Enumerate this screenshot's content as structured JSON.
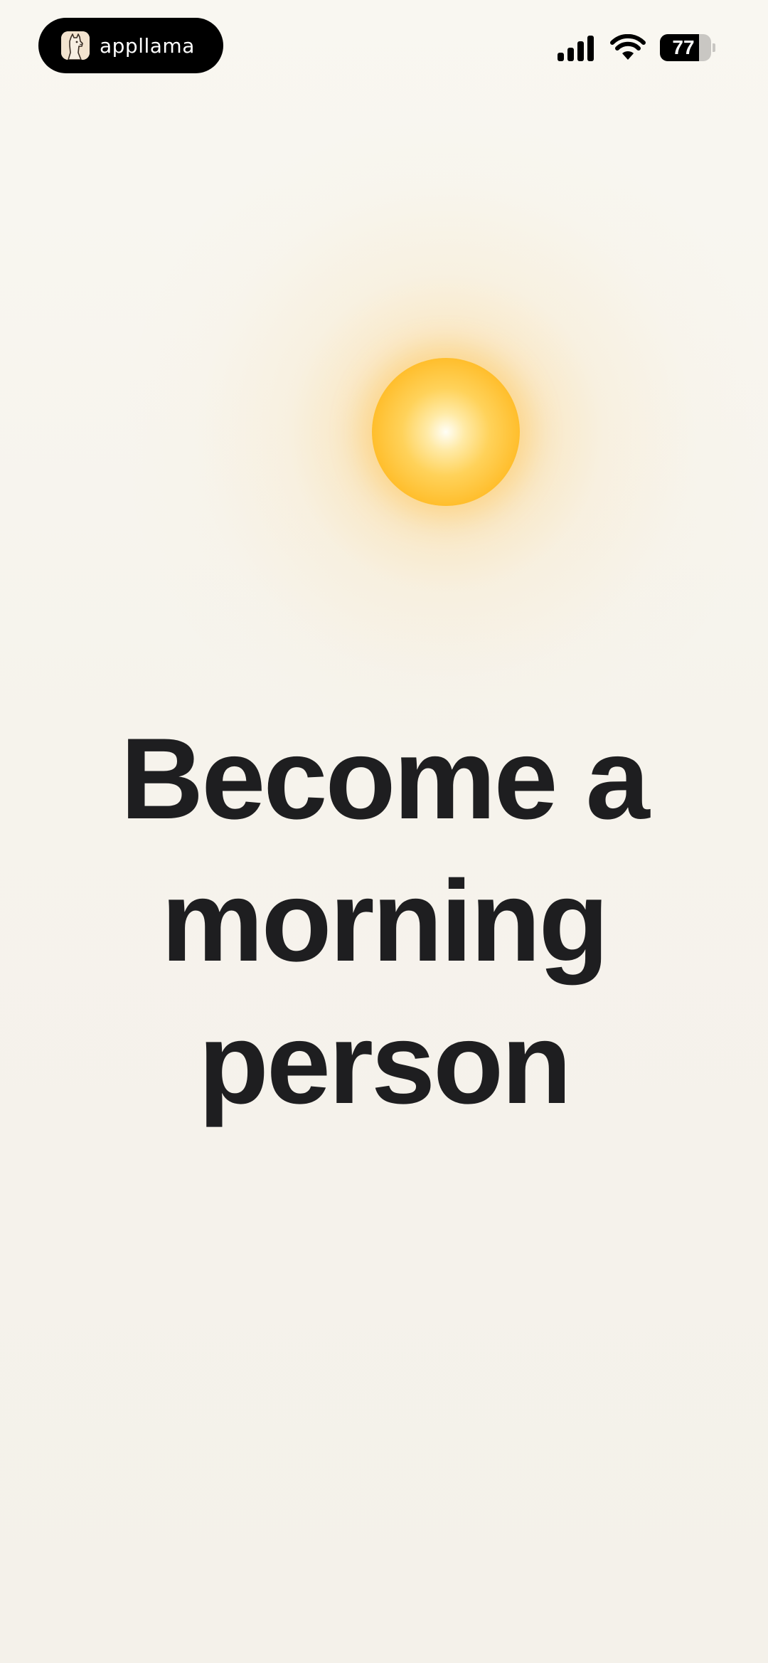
{
  "status_bar": {
    "app_name": "appllama",
    "battery_percent": "77",
    "battery_level": 0.77,
    "icons": [
      "llama-logo-icon",
      "signal-icon",
      "wifi-icon",
      "battery-icon"
    ]
  },
  "illustration": {
    "icon": "sun-icon",
    "colors": {
      "core": "#fffef6",
      "mid": "#ffd25a",
      "edge": "#f4a81d"
    }
  },
  "headline": {
    "lines": [
      "Become a",
      "morning",
      "person"
    ]
  },
  "colors": {
    "background": "#f7f4ee",
    "text": "#1e1e20"
  }
}
